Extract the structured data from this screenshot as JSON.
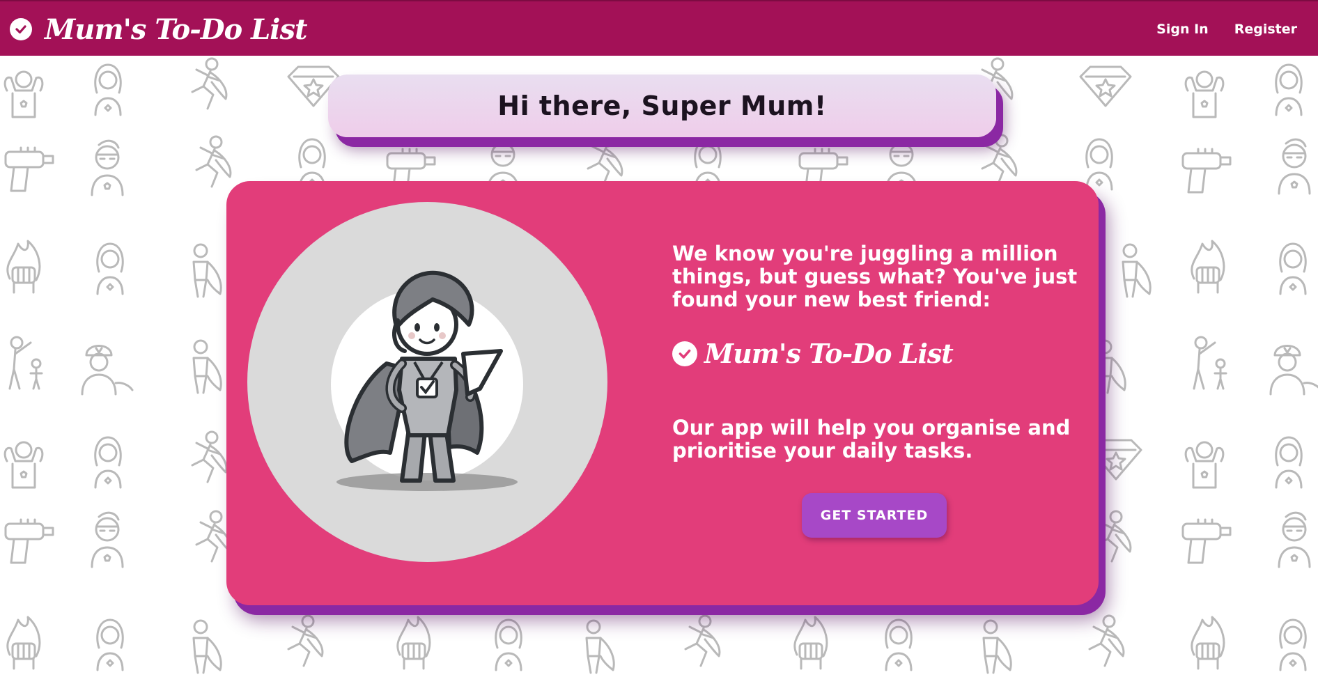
{
  "header": {
    "brand": "Mum's To-Do List",
    "links": {
      "sign_in": "Sign In",
      "register": "Register"
    }
  },
  "greeting": "Hi there, Super Mum!",
  "hero": {
    "intro": "We know you're juggling a million things, but guess what? You've just found your new best friend:",
    "brand": "Mum's To-Do List",
    "description": "Our app will help you organise and prioritise your daily tasks.",
    "cta": "GET STARTED",
    "illustration_icon": "superhero-mum-illustration"
  },
  "colors": {
    "navbar": "#a31157",
    "card": "#e23d7a",
    "card_shadow": "#8b28a3",
    "button": "#a748c7",
    "greeting_bg": "#efcdea"
  }
}
